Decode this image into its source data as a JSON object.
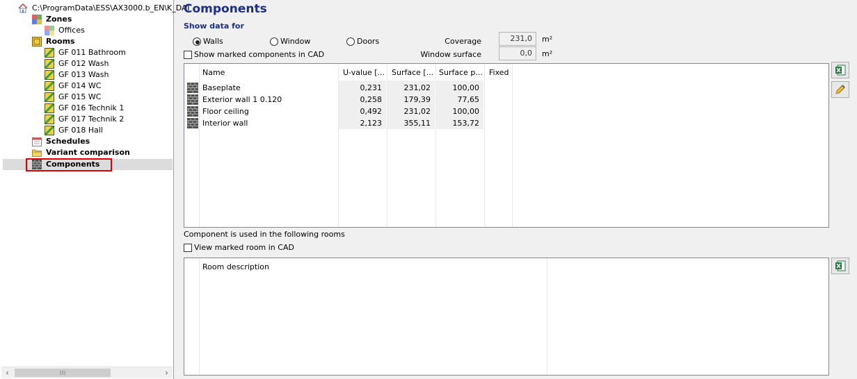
{
  "tree": {
    "root": "C:\\ProgramData\\ESS\\AX3000.b_EN\\K_DAT",
    "zones_label": "Zones",
    "offices_label": "Offices",
    "rooms_label": "Rooms",
    "rooms": [
      "GF 011 Bathroom",
      "GF 012 Wash",
      "GF 013 Wash",
      "GF 014 WC",
      "GF 015 WC",
      "GF 016 Technik 1",
      "GF 017 Technik 2",
      "GF 018 Hall"
    ],
    "schedules_label": "Schedules",
    "variant_label": "Variant comparison",
    "components_label": "Components"
  },
  "header": {
    "title": "Components",
    "show_data_for": "Show data for"
  },
  "filter": {
    "walls": "Walls",
    "window": "Window",
    "doors": "Doors",
    "selected": "Walls",
    "show_marked_cad": "Show marked components in CAD"
  },
  "summary": {
    "coverage_label": "Coverage",
    "coverage_value": "231,0",
    "window_label": "Window surface",
    "window_value": "0,0",
    "unit": "m²"
  },
  "components_table": {
    "columns": [
      "Name",
      "U-value [...",
      "Surface [...",
      "Surface p...",
      "Fixed"
    ],
    "rows": [
      {
        "name": "Baseplate",
        "u": "0,231",
        "surface": "231,02",
        "surface_p": "100,00",
        "fixed": ""
      },
      {
        "name": "Exterior wall 1 0.120",
        "u": "0,258",
        "surface": "179,39",
        "surface_p": "77,65",
        "fixed": ""
      },
      {
        "name": "Floor ceiling",
        "u": "0,492",
        "surface": "231,02",
        "surface_p": "100,00",
        "fixed": ""
      },
      {
        "name": "Interior wall",
        "u": "2,123",
        "surface": "355,11",
        "surface_p": "153,72",
        "fixed": ""
      }
    ]
  },
  "rooms_section": {
    "caption": "Component is used in the following rooms",
    "view_marked_room": "View marked room in CAD",
    "column": "Room description"
  },
  "colors": {
    "title": "#1a2e8c",
    "selection_border": "#e00000"
  }
}
